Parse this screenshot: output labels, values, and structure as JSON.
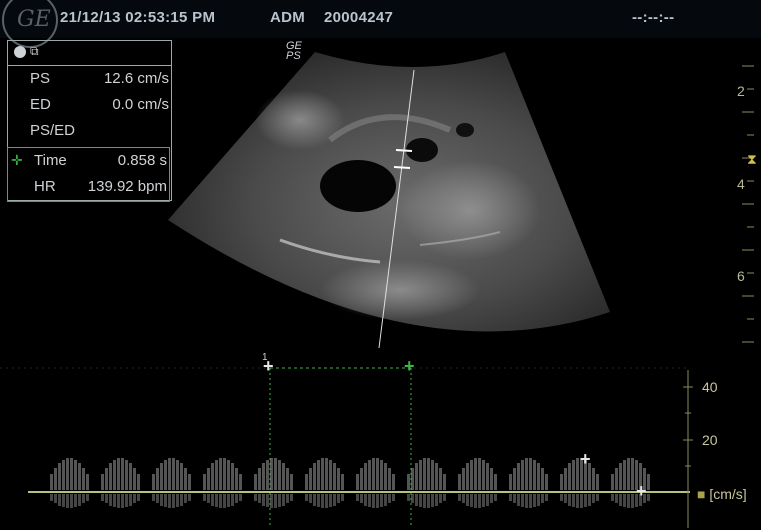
{
  "header": {
    "logo_text": "GE",
    "datetime": "21/12/13 02:53:15 PM",
    "operator": "ADM",
    "patient_id": "20004247",
    "timer": "--:--:--"
  },
  "measurements": {
    "icon": "waveform-icon",
    "rows": [
      {
        "label": "PS",
        "value": "12.6 cm/s"
      },
      {
        "label": "ED",
        "value": "0.0 cm/s"
      },
      {
        "label": "PS/ED",
        "value": ""
      }
    ],
    "active_rows": [
      {
        "label": "Time",
        "value": "0.858 s"
      },
      {
        "label": "HR",
        "value": "139.92 bpm"
      }
    ]
  },
  "image_marker": {
    "line1": "GE",
    "line2": "PS"
  },
  "depth_scale": {
    "labels": [
      "2",
      "4",
      "6"
    ],
    "focus_symbol": "⧗"
  },
  "doppler_scale": {
    "labels": [
      "40",
      "20"
    ],
    "unit": "[cm/s]",
    "caliper_number": "1"
  },
  "colors": {
    "accent_green": "#3bb54a",
    "scale_yellow": "#c8c79a",
    "baseline": "#b9c27a"
  }
}
